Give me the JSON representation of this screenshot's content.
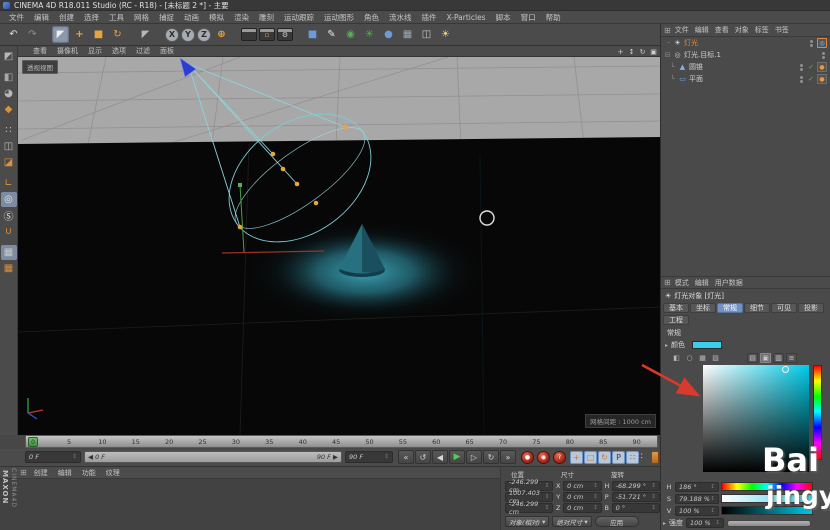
{
  "window": {
    "title": "CINEMA 4D R18.011 Studio (RC - R18) - [未标题 2 *] - 主要"
  },
  "colors": {
    "accent_cyan": "#3CCDE8",
    "selection_orange": "#E0873A",
    "tab_active_blue": "#7392C4",
    "record_red": "#B5342A",
    "play_green": "#54C85A",
    "annotation_red": "#D93A2C",
    "glow_teal": "#2D8FA0"
  },
  "ui": {
    "stepper_glyph": "↕",
    "dropdown_glyph": "▾",
    "expander_glyph": "▸",
    "expander_open_glyph": "⊟",
    "tree_branch_glyph": "└",
    "panel_icon_glyph": "⊞",
    "check_glyph": "✓",
    "slider_left_arrow": "◀",
    "slider_right_arrow": "▶"
  },
  "menu_bar": {
    "items": [
      {
        "name": "menu-file",
        "label": "文件"
      },
      {
        "name": "menu-edit",
        "label": "编辑"
      },
      {
        "name": "menu-create",
        "label": "创建"
      },
      {
        "name": "menu-select",
        "label": "选择"
      },
      {
        "name": "menu-tools",
        "label": "工具"
      },
      {
        "name": "menu-mesh",
        "label": "网格"
      },
      {
        "name": "menu-snap",
        "label": "捕捉"
      },
      {
        "name": "menu-animate",
        "label": "动画"
      },
      {
        "name": "menu-simulate",
        "label": "模拟"
      },
      {
        "name": "menu-render",
        "label": "渲染"
      },
      {
        "name": "menu-sculpt",
        "label": "雕刻"
      },
      {
        "name": "menu-motion-tracker",
        "label": "运动跟踪"
      },
      {
        "name": "menu-mograph",
        "label": "运动图形"
      },
      {
        "name": "menu-character",
        "label": "角色"
      },
      {
        "name": "menu-pipeline",
        "label": "流水线"
      },
      {
        "name": "menu-plugins",
        "label": "插件"
      },
      {
        "name": "menu-xparticles",
        "label": "X-Particles"
      },
      {
        "name": "menu-script",
        "label": "脚本"
      },
      {
        "name": "menu-window",
        "label": "窗口"
      },
      {
        "name": "menu-help",
        "label": "帮助"
      }
    ]
  },
  "toolbar": {
    "icons": [
      {
        "name": "undo-icon",
        "glyph": "↶",
        "color": "#dcdcdc"
      },
      {
        "name": "redo-icon",
        "glyph": "↷",
        "color": "#8f8f8f"
      },
      {
        "name": "toolbar-separator",
        "glyph": ""
      },
      {
        "name": "live-selection-icon",
        "glyph": "◤",
        "color": "#ededed",
        "active": true
      },
      {
        "name": "move-tool-icon",
        "glyph": "+",
        "color": "#e8a33d"
      },
      {
        "name": "scale-tool-icon",
        "glyph": "■",
        "color": "#e8a33d"
      },
      {
        "name": "rotate-tool-icon",
        "glyph": "↻",
        "color": "#e8a33d"
      },
      {
        "name": "toolbar-separator",
        "glyph": ""
      },
      {
        "name": "last-tool-icon",
        "glyph": "◤",
        "color": "#b8b8b8"
      },
      {
        "name": "toolbar-separator",
        "glyph": ""
      },
      {
        "name": "lock-x-icon",
        "glyph": "X"
      },
      {
        "name": "lock-y-icon",
        "glyph": "Y"
      },
      {
        "name": "lock-z-icon",
        "glyph": "Z"
      },
      {
        "name": "coordinate-system-icon",
        "glyph": "⊕",
        "color": "#e8a33d"
      },
      {
        "name": "toolbar-separator",
        "glyph": ""
      },
      {
        "name": "render-view-icon",
        "glyph": ""
      },
      {
        "name": "render-picture-viewer-icon",
        "glyph": "▫",
        "color": "#e8a33d"
      },
      {
        "name": "render-settings-icon",
        "glyph": "⚙",
        "color": "#cccccc"
      },
      {
        "name": "toolbar-separator",
        "glyph": ""
      },
      {
        "name": "primitive-cube-icon",
        "glyph": "■",
        "color": "#6b9ad8"
      },
      {
        "name": "pen-spline-icon",
        "glyph": "✎",
        "color": "#e6e6e6"
      },
      {
        "name": "subdivision-surface-icon",
        "glyph": "◉",
        "color": "#52b152"
      },
      {
        "name": "array-generator-icon",
        "gly_x": "",
        "glyph": "✳",
        "color": "#52b152"
      },
      {
        "name": "metaball-icon",
        "glyph": "●",
        "color": "#6b9ad8"
      },
      {
        "name": "floor-icon",
        "glyph": "▦",
        "color": "#9aa8b8"
      },
      {
        "name": "camera-icon",
        "glyph": "◫",
        "color": "#c2c8d0"
      },
      {
        "name": "light-icon",
        "glyph": "☀",
        "color": "#f0d878"
      }
    ]
  },
  "left_toolbar": {
    "icons": [
      {
        "name": "make-editable-icon",
        "glyph": "◩",
        "color": "#b8b8b8"
      },
      {
        "name": "model-mode-icon",
        "glyph": "◧",
        "color": "#a8a8a8",
        "gap": true
      },
      {
        "name": "texture-mode-icon",
        "glyph": "◕",
        "color": "#b8b8b8"
      },
      {
        "name": "workplane-mode-icon",
        "glyph": "◆",
        "color": "#d8923a"
      },
      {
        "name": "points-mode-icon",
        "glyph": "∷",
        "color": "#b8b8b8",
        "gap": true
      },
      {
        "name": "edges-mode-icon",
        "glyph": "◫",
        "color": "#b8b8b8"
      },
      {
        "name": "polygons-mode-icon",
        "glyph": "◪",
        "color": "#d8923a"
      },
      {
        "name": "axis-mode-icon",
        "glyph": "∟",
        "color": "#d8923a",
        "gap": true
      },
      {
        "name": "snap-enable-icon",
        "glyph": "◎",
        "color": "#e8e8e8",
        "active": true
      },
      {
        "name": "quantize-icon",
        "glyph": "Ⓢ",
        "color": "#d8d8d8"
      },
      {
        "name": "magnet-icon",
        "glyph": "∪",
        "color": "#d8923a"
      },
      {
        "name": "workplane-lock-icon",
        "glyph": "▦",
        "color": "#c8c8c8",
        "active": true,
        "gap": true
      },
      {
        "name": "workplane-snap-icon",
        "glyph": "▦",
        "color": "#d8923a"
      }
    ]
  },
  "viewport": {
    "menu": [
      {
        "name": "vp-menu-view",
        "label": "查看"
      },
      {
        "name": "vp-menu-camera",
        "label": "摄像机"
      },
      {
        "name": "vp-menu-display",
        "label": "显示"
      },
      {
        "name": "vp-menu-options",
        "label": "选项"
      },
      {
        "name": "vp-menu-filter",
        "label": "过滤"
      },
      {
        "name": "vp-menu-panel",
        "label": "面板"
      }
    ],
    "nav_icons": [
      {
        "name": "pan-view-icon",
        "glyph": "+"
      },
      {
        "name": "dolly-view-icon",
        "glyph": "↕"
      },
      {
        "name": "orbit-view-icon",
        "glyph": "↻"
      },
      {
        "name": "toggle-view-icon",
        "glyph": "▣"
      }
    ],
    "view_label": "透视视图",
    "grid_spacing_label": "网格间距 : 1000 cm"
  },
  "timeline": {
    "marker_frame": "0",
    "ticks": [
      "0",
      "5",
      "10",
      "15",
      "20",
      "25",
      "30",
      "35",
      "40",
      "45",
      "50",
      "55",
      "60",
      "65",
      "70",
      "75",
      "80",
      "85",
      "90"
    ],
    "start_field": "0 F",
    "end_field": "90 F",
    "range_start": "0 F",
    "range_end": "90 F"
  },
  "transport": {
    "buttons": [
      {
        "name": "goto-start-button",
        "glyph": "«"
      },
      {
        "name": "goto-prev-key-button",
        "glyph": "↺"
      },
      {
        "name": "prev-frame-button",
        "glyph": "◀"
      },
      {
        "name": "play-button",
        "glyph": "▶",
        "active": true
      },
      {
        "name": "next-frame-button",
        "glyph": "▷"
      },
      {
        "name": "goto-next-key-button",
        "glyph": "↻"
      },
      {
        "name": "goto-end-button",
        "glyph": "»"
      }
    ],
    "record_buttons": [
      {
        "name": "record-keyframe-button",
        "glyph": "●"
      },
      {
        "name": "autokey-button",
        "glyph": "◉"
      },
      {
        "name": "keyframe-selection-button",
        "glyph": "?"
      }
    ],
    "keyframe_toggles": [
      {
        "name": "key-position-toggle",
        "glyph": "+",
        "color": "#d07a28"
      },
      {
        "name": "key-scale-toggle",
        "glyph": "□",
        "color": "#d07a28"
      },
      {
        "name": "key-rotation-toggle",
        "glyph": "↻",
        "color": "#d07a28"
      },
      {
        "name": "key-parameter-toggle",
        "glyph": "P",
        "color": "#3a3a3a"
      },
      {
        "name": "key-pla-toggle",
        "glyph": "∷",
        "color": "#666666"
      }
    ]
  },
  "materials_panel": {
    "menu": [
      {
        "name": "mat-menu-create",
        "label": "创建"
      },
      {
        "name": "mat-menu-edit",
        "label": "编辑"
      },
      {
        "name": "mat-menu-function",
        "label": "功能"
      },
      {
        "name": "mat-menu-texture",
        "label": "纹理"
      }
    ],
    "brand_primary": "MAXON",
    "brand_secondary": "CINEMA4D"
  },
  "coordinates": {
    "headers": [
      {
        "name": "position-header",
        "label": "位置"
      },
      {
        "name": "size-header",
        "label": "尺寸"
      },
      {
        "name": "rotation-header",
        "label": "旋转"
      }
    ],
    "rows": [
      {
        "name": "coord-row-x",
        "pos": "-246.299 cm",
        "axis": "X",
        "size": "0 cm",
        "rot_axis": "H",
        "rot": "-68.299 °"
      },
      {
        "name": "coord-row-y",
        "pos": "1007.403 cm",
        "axis": "Y",
        "size": "0 cm",
        "rot_axis": "P",
        "rot": "-51.721 °"
      },
      {
        "name": "coord-row-z",
        "pos": "-246.299 cm",
        "axis": "Z",
        "size": "0 cm",
        "rot_axis": "B",
        "rot": "0 °"
      }
    ],
    "mode_dropdown": "对象(相对)",
    "size_dropdown": "绝对尺寸",
    "apply_label": "应用"
  },
  "object_manager": {
    "menu": [
      {
        "name": "om-menu-file",
        "label": "文件"
      },
      {
        "name": "om-menu-edit",
        "label": "编辑"
      },
      {
        "name": "om-menu-view",
        "label": "查看"
      },
      {
        "name": "om-menu-objects",
        "label": "对象"
      },
      {
        "name": "om-menu-tags",
        "label": "标签"
      },
      {
        "name": "om-menu-bookmarks",
        "label": "书签"
      }
    ],
    "objects": [
      {
        "label": "灯光",
        "icon_glyph": "☀",
        "selected": true
      },
      {
        "label": "灯光.目标.1",
        "icon_glyph": "◎"
      },
      {
        "label": "圆锥",
        "icon_glyph": "▲"
      },
      {
        "label": "平面",
        "icon_glyph": "▭"
      }
    ],
    "tag_target_glyph": "◎",
    "tag_phong_glyph": "●"
  },
  "attribute_manager": {
    "menu": [
      {
        "name": "am-menu-mode",
        "label": "模式"
      },
      {
        "name": "am-menu-edit",
        "label": "编辑"
      },
      {
        "name": "am-menu-userdata",
        "label": "用户数据"
      }
    ],
    "title": "灯光对象 [灯光]",
    "title_icon_glyph": "☀",
    "tabs_row1": [
      {
        "name": "tab-basic",
        "label": "基本"
      },
      {
        "name": "tab-coordinates",
        "label": "坐标"
      },
      {
        "name": "tab-general",
        "label": "常规",
        "active": true
      },
      {
        "name": "tab-details",
        "label": "细节"
      },
      {
        "name": "tab-visibility",
        "label": "可见"
      },
      {
        "name": "tab-shadow",
        "label": "投影"
      }
    ],
    "tabs_row2": [
      {
        "name": "tab-project",
        "label": "工程"
      }
    ],
    "section_label": "常规",
    "color_label": "颜色",
    "swatch_color": "#3CCDE8",
    "picker_tools": [
      {
        "name": "picker-compact-icon",
        "glyph": "◧"
      },
      {
        "name": "picker-wheel-icon",
        "glyph": "○"
      },
      {
        "name": "picker-spectrum-icon",
        "glyph": "▦"
      },
      {
        "name": "picker-image-icon",
        "glyph": "▨"
      }
    ],
    "picker_modes": [
      {
        "name": "rgb-mode-icon",
        "glyph": "▤"
      },
      {
        "name": "hsv-mode-icon",
        "glyph": "▣",
        "active": true
      },
      {
        "name": "kelvin-mode-icon",
        "glyph": "▥"
      },
      {
        "name": "mixer-mode-icon",
        "glyph": "≡"
      }
    ],
    "hue": {
      "label": "H",
      "value": "186 °"
    },
    "saturation": {
      "label": "S",
      "value": "79.188 %"
    },
    "value_row": {
      "label": "V",
      "value": "100 %"
    },
    "intensity": {
      "label": "强度",
      "value": "100 %"
    }
  },
  "watermark": {
    "line1": "Bai",
    "line2": "jingya"
  }
}
